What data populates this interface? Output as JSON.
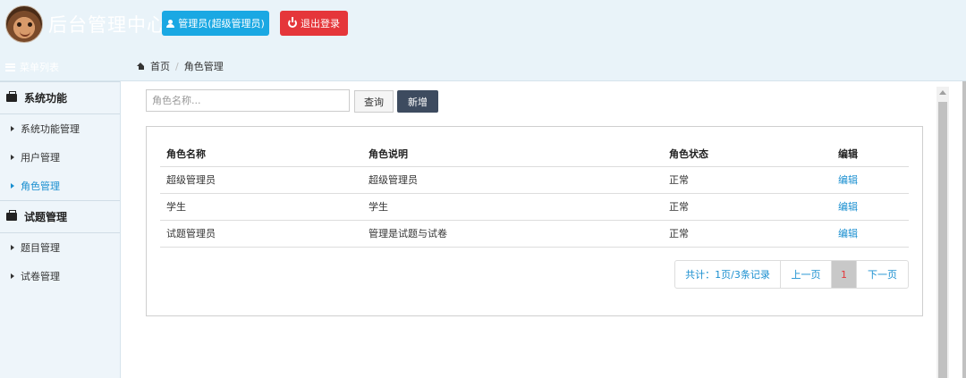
{
  "header": {
    "app_title": "后台管理中心",
    "admin_button": "管理员(超级管理员)",
    "logout_button": "退出登录"
  },
  "subbar": {
    "menu_list_title": "菜单列表",
    "breadcrumb": {
      "home": "首页",
      "current": "角色管理"
    }
  },
  "sidebar": {
    "groups": [
      {
        "label": "系统功能",
        "items": [
          {
            "label": "系统功能管理"
          },
          {
            "label": "用户管理"
          },
          {
            "label": "角色管理"
          }
        ]
      },
      {
        "label": "试题管理",
        "items": [
          {
            "label": "题目管理"
          },
          {
            "label": "试卷管理"
          }
        ]
      }
    ],
    "active_item": "角色管理"
  },
  "search": {
    "placeholder": "角色名称...",
    "value": ""
  },
  "toolbar": {
    "query_label": "查询",
    "add_label": "新增"
  },
  "table": {
    "headers": [
      "角色名称",
      "角色说明",
      "角色状态",
      "编辑"
    ],
    "rows": [
      [
        "超级管理员",
        "超级管理员",
        "正常",
        "编辑"
      ],
      [
        "学生",
        "学生",
        "正常",
        "编辑"
      ],
      [
        "试题管理员",
        "管理是试题与试卷",
        "正常",
        "编辑"
      ]
    ]
  },
  "pagination": {
    "total_label": "共计：1页/3条记录",
    "prev_label": "上一页",
    "current_page": "1",
    "next_label": "下一页"
  },
  "colors": {
    "header_bg": "#e9f3f9",
    "admin_btn": "#1aa8e3",
    "logout_btn": "#e5363a",
    "add_btn": "#3d4b5f",
    "link": "#1a8fd0"
  }
}
